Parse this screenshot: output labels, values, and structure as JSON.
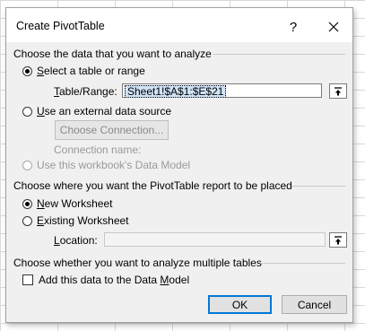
{
  "dialog": {
    "title": "Create PivotTable",
    "help_label": "?",
    "close_icon": "close-icon"
  },
  "data_source": {
    "heading": "Choose the data that you want to analyze",
    "select_range": {
      "prefix": "",
      "accel": "S",
      "rest": "elect a table or range",
      "checked": true
    },
    "table_range": {
      "label_accel": "T",
      "label_rest": "able/Range:",
      "value": "Sheet1!$A$1:$E$21"
    },
    "external": {
      "accel": "U",
      "rest": "se an external data source",
      "checked": false
    },
    "choose_connection_label": "Choose Connection...",
    "connection_name_label": "Connection name:",
    "data_model_option": {
      "label": "Use this workbook's Data Model",
      "disabled": true
    }
  },
  "placement": {
    "heading": "Choose where you want the PivotTable report to be placed",
    "new_worksheet": {
      "accel": "N",
      "rest": "ew Worksheet",
      "checked": true
    },
    "existing_worksheet": {
      "accel": "E",
      "rest": "xisting Worksheet",
      "checked": false
    },
    "location": {
      "accel": "L",
      "rest": "ocation:",
      "value": ""
    }
  },
  "multiple_tables": {
    "heading": "Choose whether you want to analyze multiple tables",
    "add_to_model": {
      "before": "Add this data to the Data ",
      "accel": "M",
      "after": "odel",
      "checked": false
    }
  },
  "buttons": {
    "ok_label": "OK",
    "cancel_label": "Cancel"
  },
  "icons": {
    "collapse": "collapse-dialog-icon",
    "close": "close-icon"
  }
}
